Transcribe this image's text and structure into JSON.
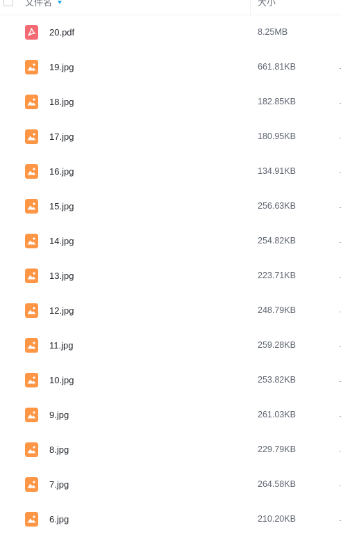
{
  "header": {
    "name_label": "文件名",
    "size_label": "大小"
  },
  "files": [
    {
      "name": "20.pdf",
      "size": "8.25MB",
      "icon": "pdf-icon",
      "color": "#f36a73"
    },
    {
      "name": "19.jpg",
      "size": "661.81KB",
      "icon": "image-icon",
      "color": "#ff9645"
    },
    {
      "name": "18.jpg",
      "size": "182.85KB",
      "icon": "image-icon",
      "color": "#ff9645"
    },
    {
      "name": "17.jpg",
      "size": "180.95KB",
      "icon": "image-icon",
      "color": "#ff9645"
    },
    {
      "name": "16.jpg",
      "size": "134.91KB",
      "icon": "image-icon",
      "color": "#ff9645"
    },
    {
      "name": "15.jpg",
      "size": "256.63KB",
      "icon": "image-icon",
      "color": "#ff9645"
    },
    {
      "name": "14.jpg",
      "size": "254.82KB",
      "icon": "image-icon",
      "color": "#ff9645"
    },
    {
      "name": "13.jpg",
      "size": "223.71KB",
      "icon": "image-icon",
      "color": "#ff9645"
    },
    {
      "name": "12.jpg",
      "size": "248.79KB",
      "icon": "image-icon",
      "color": "#ff9645"
    },
    {
      "name": "11.jpg",
      "size": "259.28KB",
      "icon": "image-icon",
      "color": "#ff9645"
    },
    {
      "name": "10.jpg",
      "size": "253.82KB",
      "icon": "image-icon",
      "color": "#ff9645"
    },
    {
      "name": "9.jpg",
      "size": "261.03KB",
      "icon": "image-icon",
      "color": "#ff9645"
    },
    {
      "name": "8.jpg",
      "size": "229.79KB",
      "icon": "image-icon",
      "color": "#ff9645"
    },
    {
      "name": "7.jpg",
      "size": "264.58KB",
      "icon": "image-icon",
      "color": "#ff9645"
    },
    {
      "name": "6.jpg",
      "size": "210.20KB",
      "icon": "image-icon",
      "color": "#ff9645"
    }
  ]
}
